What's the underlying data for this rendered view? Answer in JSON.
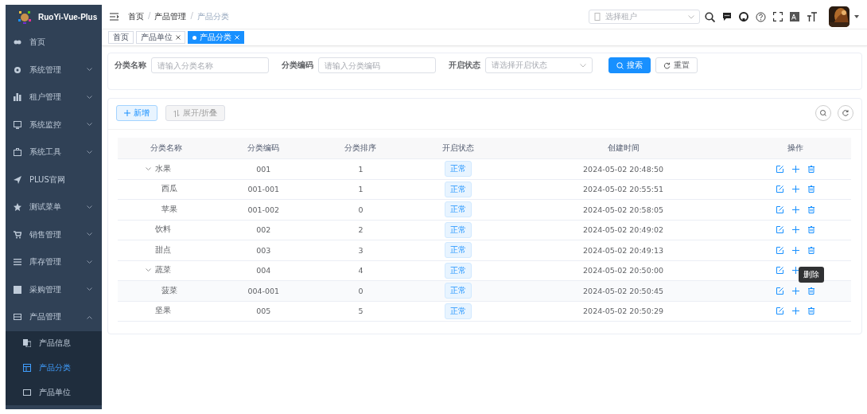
{
  "app": {
    "title": "RuoYi-Vue-Plus"
  },
  "sidebar": {
    "items": [
      {
        "label": "首页"
      },
      {
        "label": "系统管理",
        "expanded": false
      },
      {
        "label": "租户管理",
        "expanded": false
      },
      {
        "label": "系统监控",
        "expanded": false
      },
      {
        "label": "系统工具",
        "expanded": false
      },
      {
        "label": "PLUS官网"
      },
      {
        "label": "测试菜单",
        "expanded": false
      },
      {
        "label": "销售管理",
        "expanded": false
      },
      {
        "label": "库存管理",
        "expanded": false
      },
      {
        "label": "采购管理",
        "expanded": false
      },
      {
        "label": "产品管理",
        "expanded": true,
        "children": [
          {
            "label": "产品信息",
            "selected": false
          },
          {
            "label": "产品分类",
            "selected": true
          },
          {
            "label": "产品单位",
            "selected": false
          }
        ]
      }
    ]
  },
  "breadcrumb": {
    "separator": "/",
    "items": [
      "首页",
      "产品管理",
      "产品分类"
    ]
  },
  "tenant_select": {
    "placeholder": "选择租户"
  },
  "tags": [
    {
      "label": "首页",
      "selected": false,
      "closable": false
    },
    {
      "label": "产品单位",
      "selected": false,
      "closable": true
    },
    {
      "label": "产品分类",
      "selected": true,
      "closable": true
    }
  ],
  "search_form": {
    "fields": [
      {
        "label": "分类名称",
        "kind": "input",
        "placeholder": "请输入分类名称"
      },
      {
        "label": "分类编码",
        "kind": "input",
        "placeholder": "请输入分类编码"
      },
      {
        "label": "开启状态",
        "kind": "select",
        "placeholder": "请选择开启状态"
      }
    ],
    "search_button": "搜索",
    "reset_button": "重置"
  },
  "toolbar": {
    "add_button": "新增",
    "expand_button": "展开/折叠"
  },
  "table": {
    "columns": [
      "分类名称",
      "分类编码",
      "分类排序",
      "开启状态",
      "创建时间",
      "操作"
    ],
    "rows": [
      {
        "name": "水果",
        "code": "001",
        "sort": "1",
        "status": "正常",
        "created": "2024-05-02 20:48:50",
        "expanded": true,
        "children": [
          {
            "name": "西瓜",
            "code": "001-001",
            "sort": "1",
            "status": "正常",
            "created": "2024-05-02 20:55:51"
          },
          {
            "name": "苹果",
            "code": "001-002",
            "sort": "0",
            "status": "正常",
            "created": "2024-05-02 20:58:05"
          }
        ]
      },
      {
        "name": "饮料",
        "code": "002",
        "sort": "2",
        "status": "正常",
        "created": "2024-05-02 20:49:02"
      },
      {
        "name": "甜点",
        "code": "003",
        "sort": "3",
        "status": "正常",
        "created": "2024-05-02 20:49:13"
      },
      {
        "name": "蔬菜",
        "code": "004",
        "sort": "4",
        "status": "正常",
        "created": "2024-05-02 20:50:00",
        "expanded": true,
        "children": [
          {
            "name": "菠菜",
            "code": "004-001",
            "sort": "0",
            "status": "正常",
            "created": "2024-05-02 20:50:45",
            "hovered": true,
            "tooltip": "删除"
          }
        ]
      },
      {
        "name": "坚果",
        "code": "005",
        "sort": "5",
        "status": "正常",
        "created": "2024-05-02 20:50:29"
      }
    ]
  }
}
